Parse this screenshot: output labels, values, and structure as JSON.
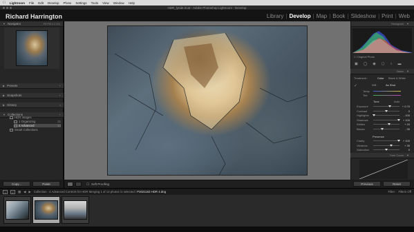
{
  "menubar": {
    "app": "Lightroom",
    "items": [
      "File",
      "Edit",
      "Develop",
      "Photo",
      "Settings",
      "Tools",
      "View",
      "Window",
      "Help"
    ]
  },
  "window": {
    "title": "HDR_lynde.lrcat - Adobe Photoshop Lightroom - Develop"
  },
  "identity_plate": "Richard Harrington",
  "modules": [
    {
      "label": "Library",
      "active": false
    },
    {
      "label": "Develop",
      "active": true
    },
    {
      "label": "Map",
      "active": false
    },
    {
      "label": "Book",
      "active": false
    },
    {
      "label": "Slideshow",
      "active": false
    },
    {
      "label": "Print",
      "active": false
    },
    {
      "label": "Web",
      "active": false
    }
  ],
  "left_panel": {
    "navigator": "Navigator",
    "navigator_zoom": "Fit   Fill   1:1   3:1",
    "presets": "Presets",
    "snapshots": "Snapshots",
    "history": "History",
    "collections": "Collections",
    "collection_items": [
      {
        "label": "HDR Images",
        "count": ""
      },
      {
        "label": "1 Organizing",
        "count": "21"
      },
      {
        "label": "4 Advanced",
        "count": "13"
      },
      {
        "label": "Smart Collections",
        "count": ""
      }
    ],
    "copy_btn": "Copy...",
    "paste_btn": "Paste"
  },
  "toolbar": {
    "soft_proofing": "Soft Proofing"
  },
  "right_panel": {
    "histogram": "Histogram",
    "original_photo": "Original Photo",
    "basic": "Basic",
    "treatment": "Treatment :",
    "color": "Color",
    "bw": "Black & White",
    "wb": "WB :",
    "as_shot": "As Shot",
    "temp": "Temp",
    "tint": "Tint",
    "tone": "Tone",
    "auto": "Auto",
    "sliders": [
      {
        "label": "Exposure",
        "value": "+ 0.70",
        "pos": 0.62
      },
      {
        "label": "Contrast",
        "value": "0",
        "pos": 0.5
      },
      {
        "label": "Highlights",
        "value": "- 100",
        "pos": 0.02
      },
      {
        "label": "Shadows",
        "value": "+ 100",
        "pos": 0.98
      },
      {
        "label": "Whites",
        "value": "+ 20",
        "pos": 0.6
      },
      {
        "label": "Blacks",
        "value": "- 30",
        "pos": 0.35
      }
    ],
    "presence": "Presence",
    "presence_sliders": [
      {
        "label": "Clarity",
        "value": "+ 100",
        "pos": 0.98
      },
      {
        "label": "Vibrance",
        "value": "+ 35",
        "pos": 0.68
      },
      {
        "label": "Saturation",
        "value": "0",
        "pos": 0.5
      }
    ],
    "tone_curve": "Tone Curve",
    "previous_btn": "Previous",
    "reset_btn": "Reset"
  },
  "filmstrip": {
    "page1": "1",
    "page2": "2",
    "path_prefix": "Collection : 4 Advanced Controls for HDR Merging",
    "path_count": "1 of 13 photos /1 selected /",
    "path_file": "P2021163 HDR 4.dng",
    "filter_label": "Filter :",
    "filter_value": "Filters Off"
  }
}
